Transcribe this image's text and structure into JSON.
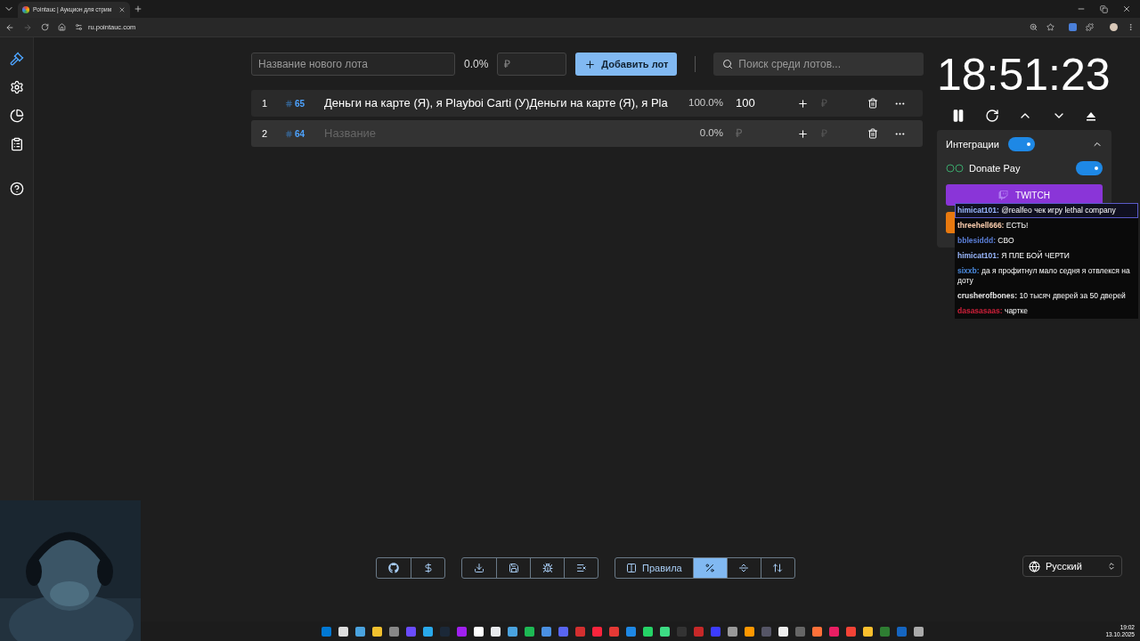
{
  "browser": {
    "tab_title": "Pointauc | Аукцион для стрим",
    "url": "ru.pointauc.com"
  },
  "sidebar": {
    "items": [
      {
        "selected": true
      },
      {
        "selected": false
      },
      {
        "selected": false
      },
      {
        "selected": false
      },
      {
        "selected": false
      }
    ]
  },
  "new_lot": {
    "name_placeholder": "Название нового лота",
    "percent": "0.0%",
    "amount_placeholder": "₽",
    "add_button": "Добавить лот"
  },
  "search": {
    "placeholder": "Поиск среди лотов..."
  },
  "lots": [
    {
      "index": "1",
      "id": "65",
      "name": "Деньги на карте (Я), я Playboi Carti (У)Деньги на карте (Я), я Pla",
      "percent": "100.0%",
      "amount": "100",
      "add_placeholder": "₽"
    },
    {
      "index": "2",
      "id": "64",
      "name_placeholder": "Название",
      "percent": "0.0%",
      "amount_placeholder": "₽",
      "add_placeholder": "₽"
    }
  ],
  "timer": "18:51:23",
  "integrations": {
    "title": "Интеграции",
    "on": true,
    "expanded": true,
    "items": [
      {
        "name": "Donate Pay",
        "on": true
      }
    ],
    "twitch_button": "TWITCH"
  },
  "chat": [
    {
      "user": "himicat101:",
      "color": "#9ab8ff",
      "text": "@realfeo чек игру lethal company",
      "highlighted": true
    },
    {
      "user": "threehell666:",
      "color": "#ffd0b0",
      "text": "ЕСТЬ!",
      "highlighted": false
    },
    {
      "user": "bblesiddd:",
      "color": "#5b7fd9",
      "text": "СВО",
      "highlighted": false
    },
    {
      "user": "himicat101:",
      "color": "#9ab8ff",
      "text": "Я ПЛЕ БОЙ ЧЕРТИ",
      "highlighted": false
    },
    {
      "user": "sixxb:",
      "color": "#4b8be0",
      "text": "да я профитнул мало седня я отвлекся на доту",
      "highlighted": false
    },
    {
      "user": "crusherofbones:",
      "color": "#e6e6e6",
      "text": "10 тысяч дверей за 50 дверей",
      "highlighted": false
    },
    {
      "user": "dasasasaas:",
      "color": "#d0203a",
      "text": "чартке",
      "highlighted": false
    }
  ],
  "toolbar": [
    [
      {
        "kind": "github",
        "selected": false
      },
      {
        "kind": "donate",
        "selected": false
      }
    ],
    [
      {
        "kind": "download",
        "selected": false
      },
      {
        "kind": "save",
        "selected": false
      },
      {
        "kind": "bug",
        "selected": false
      },
      {
        "kind": "clear",
        "selected": false
      }
    ],
    [
      {
        "kind": "rules",
        "label": "Правила",
        "selected": false
      },
      {
        "kind": "percent",
        "selected": true
      },
      {
        "kind": "split",
        "selected": false
      },
      {
        "kind": "sort",
        "selected": false
      }
    ]
  ],
  "language": "Русский",
  "taskbar": {
    "time": "19:02",
    "date": "13.10.2025"
  }
}
